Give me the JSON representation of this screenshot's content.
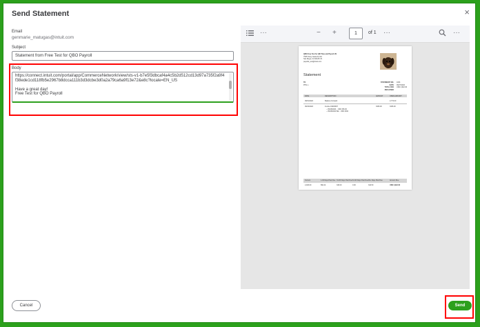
{
  "dialog": {
    "title": "Send Statement",
    "close_glyph": "×"
  },
  "form": {
    "email_label": "Email",
    "email_value": "genmarie_matugas@intuit.com",
    "subject_label": "Subject",
    "subject_value": "Statement from Free Test for QBO Payroll",
    "body_label": "Body",
    "body_value": "https://connect.intuit.com/portal/app/CommerceNetwork/view/sts-v1-b7e5f3dbcaf4a4c5b2d512cd13d97a735f2a9f4f38ede1cd118fb5e2967b8dcca111b3d3dcbe3d0a2a79ca6a9f13e72&e8c?locale=EN_US\n\nHave a great day!\nFree Test for QBO Payroll"
  },
  "preview_toolbar": {
    "list_icon": "list-icon",
    "more_glyph": "···",
    "zoom_out": "−",
    "zoom_in": "+",
    "page_current": "1",
    "page_total": "of 1",
    "search_icon": "search-icon"
  },
  "statement_preview": {
    "company_name": "QBO Free Test for QB Time and Payroll JS",
    "address_line_1": "7535 Torrey Santa Fe Rd",
    "address_line_2": "San Diego, CA 92129 US",
    "company_email": "payrolls_test@intuit.com",
    "heading": "Statement",
    "to_label": "TO",
    "customer": "PHIL L.",
    "meta": [
      {
        "label": "STATEMENT NO.",
        "value": "1034"
      },
      {
        "label": "DATE",
        "value": "09/27/2024"
      },
      {
        "label": "TOTAL DUE",
        "value": "USD 2,942.00"
      },
      {
        "label": "ENCLOSED",
        "value": ""
      }
    ],
    "table_headers": [
      "DATE",
      "DESCRIPTION",
      "AMOUNT",
      "OPEN AMOUNT"
    ],
    "rows": [
      {
        "date": "09/01/2024",
        "description": "Balance Forward",
        "amount": "",
        "open": "2,772.00"
      },
      {
        "date": "09/16/2024",
        "description": "Invoice #1003497",
        "amount": "3346.00",
        "open": "3346.00"
      }
    ],
    "row_subitems": [
      "-- 09/16/2024 ₋ USD 336.00",
      "-- 09/16/2024 Bal ₋ USD 2942"
    ],
    "aging_headers": [
      "Current",
      "1-30 Days Past Due",
      "31-60 Days Past Due",
      "61-90 Days Past Due",
      "90+ Days Past Due",
      "Amount Due"
    ],
    "aging_values": [
      "2,406.00",
      "892.44",
      "346.00",
      "0.00",
      "342.50",
      "USD 2,942.00"
    ]
  },
  "footer": {
    "cancel_label": "Cancel",
    "send_label": "Send"
  },
  "colors": {
    "accent": "#2ca01c",
    "annotation": "#ff0000"
  }
}
